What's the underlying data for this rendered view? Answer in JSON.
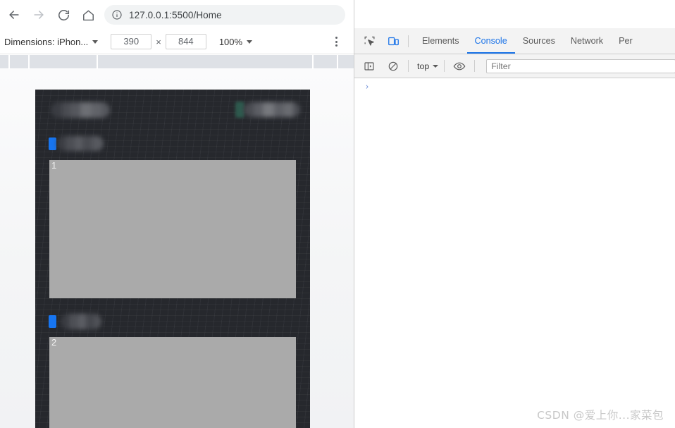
{
  "browser": {
    "nav": {
      "back_icon": "arrow-left-icon",
      "forward_icon": "arrow-right-icon",
      "reload_icon": "reload-icon",
      "home_icon": "home-icon"
    },
    "omnibox": {
      "info_icon": "site-info-icon",
      "url": "127.0.0.1:5500/Home"
    }
  },
  "device_toolbar": {
    "dimensions_label": "Dimensions: iPhon...",
    "width": "390",
    "height": "844",
    "times": "×",
    "zoom": "100%",
    "more_icon": "kebab-menu-icon"
  },
  "ruler": {
    "ticks": [
      12,
      40,
      137,
      443,
      478
    ]
  },
  "phone": {
    "background_color": "#26282d",
    "accent_blue": "#1775f1",
    "accent_green": "#2e5a4e",
    "block_color": "#aaaaaa",
    "rows": [
      {
        "number": "1",
        "label_accent": "#1775f1",
        "label_redacted": true
      },
      {
        "number": "2",
        "label_accent": "#1775f1",
        "label_redacted": true
      }
    ],
    "header": {
      "left_redacted": true,
      "right_accent": "#2e5a4e",
      "right_redacted": true
    }
  },
  "devtools": {
    "inspect_icon": "inspect-element-icon",
    "device_toggle_icon": "device-toolbar-icon",
    "tabs": [
      {
        "label": "Elements",
        "selected": false
      },
      {
        "label": "Console",
        "selected": true
      },
      {
        "label": "Sources",
        "selected": false
      },
      {
        "label": "Network",
        "selected": false
      },
      {
        "label": "Per",
        "selected": false
      }
    ],
    "console_toolbar": {
      "sidebar_icon": "console-sidebar-icon",
      "clear_icon": "clear-console-icon",
      "context": "top",
      "eye_icon": "live-expression-icon",
      "filter_placeholder": "Filter",
      "filter_value": ""
    },
    "prompt_caret": "›"
  },
  "watermark": {
    "text": "CSDN @爱上你...家菜包"
  },
  "colors": {
    "devtools_accent": "#1a73e8",
    "omnibox_bg": "#f1f3f4",
    "ruler_bg": "#dee1e6"
  }
}
